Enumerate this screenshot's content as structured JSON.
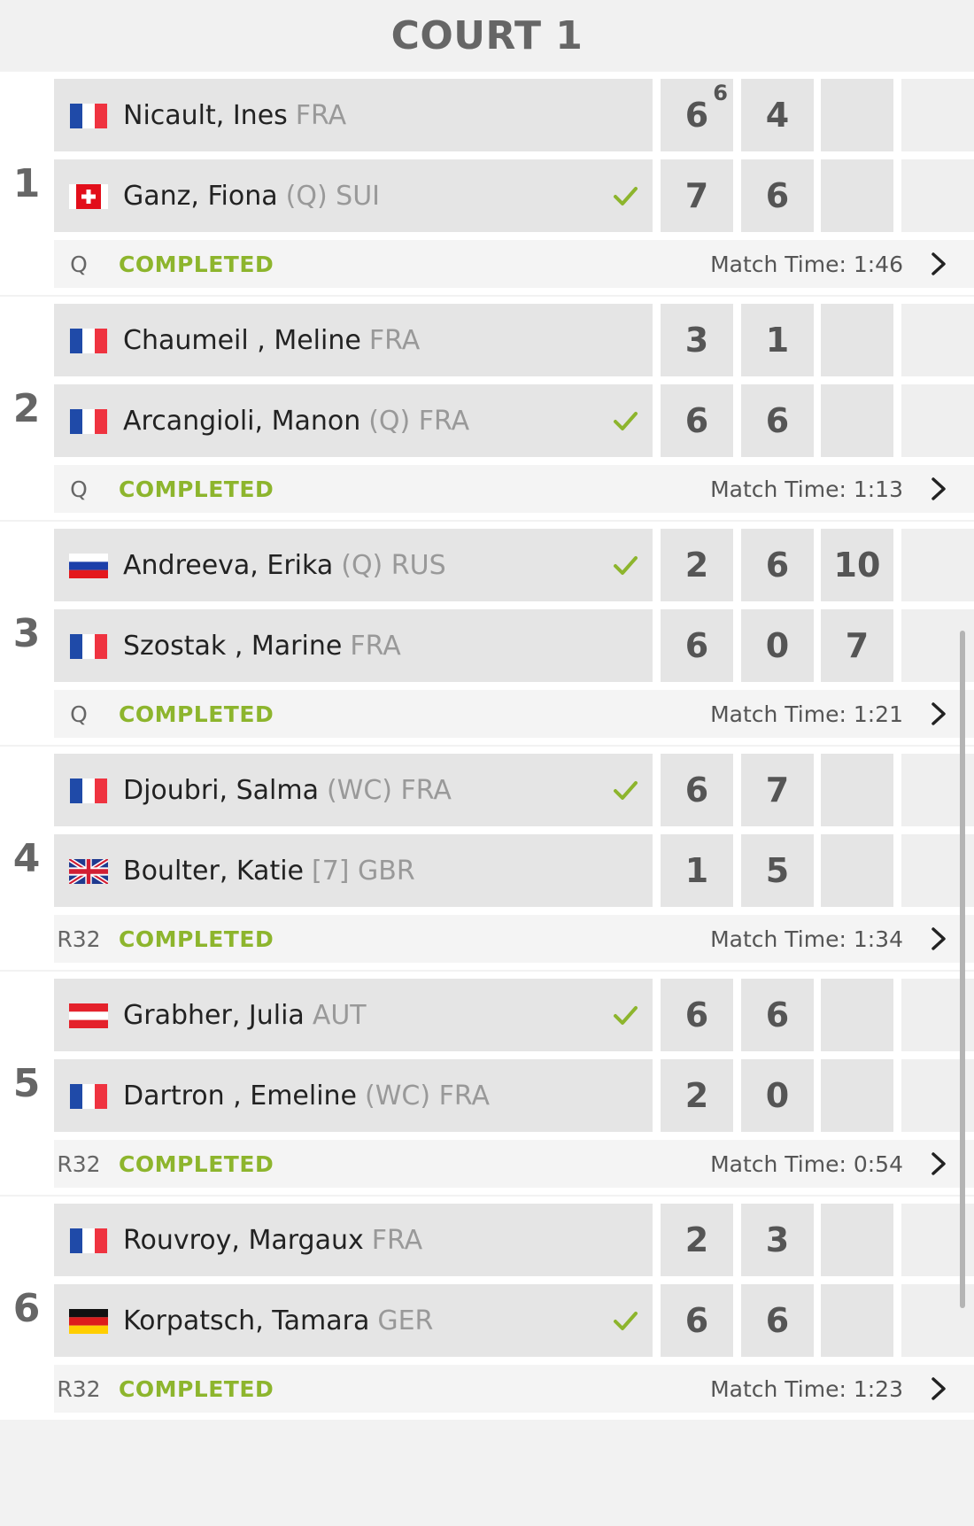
{
  "court": {
    "title": "COURT 1"
  },
  "matches": [
    {
      "num": "1",
      "round": "Q",
      "status": "COMPLETED",
      "match_time": "Match Time: 1:46",
      "players": [
        {
          "name": "Nicault, Ines",
          "extra": "FRA",
          "flag": "fra",
          "winner": false,
          "scores": [
            "6",
            "4",
            ""
          ],
          "tiebreak": [
            "6",
            "",
            ""
          ]
        },
        {
          "name": "Ganz, Fiona",
          "extra": "(Q) SUI",
          "flag": "sui",
          "winner": true,
          "scores": [
            "7",
            "6",
            ""
          ],
          "tiebreak": [
            "",
            "",
            ""
          ]
        }
      ]
    },
    {
      "num": "2",
      "round": "Q",
      "status": "COMPLETED",
      "match_time": "Match Time: 1:13",
      "players": [
        {
          "name": "Chaumeil , Meline",
          "extra": "FRA",
          "flag": "fra",
          "winner": false,
          "scores": [
            "3",
            "1",
            ""
          ],
          "tiebreak": [
            "",
            "",
            ""
          ]
        },
        {
          "name": "Arcangioli, Manon",
          "extra": "(Q) FRA",
          "flag": "fra",
          "winner": true,
          "scores": [
            "6",
            "6",
            ""
          ],
          "tiebreak": [
            "",
            "",
            ""
          ]
        }
      ]
    },
    {
      "num": "3",
      "round": "Q",
      "status": "COMPLETED",
      "match_time": "Match Time: 1:21",
      "players": [
        {
          "name": "Andreeva, Erika",
          "extra": "(Q) RUS",
          "flag": "rus",
          "winner": true,
          "scores": [
            "2",
            "6",
            "10"
          ],
          "tiebreak": [
            "",
            "",
            ""
          ]
        },
        {
          "name": "Szostak , Marine",
          "extra": "FRA",
          "flag": "fra",
          "winner": false,
          "scores": [
            "6",
            "0",
            "7"
          ],
          "tiebreak": [
            "",
            "",
            ""
          ]
        }
      ]
    },
    {
      "num": "4",
      "round": "R32",
      "status": "COMPLETED",
      "match_time": "Match Time: 1:34",
      "players": [
        {
          "name": "Djoubri, Salma",
          "extra": "(WC) FRA",
          "flag": "fra",
          "winner": true,
          "scores": [
            "6",
            "7",
            ""
          ],
          "tiebreak": [
            "",
            "",
            ""
          ]
        },
        {
          "name": "Boulter, Katie",
          "extra": "[7] GBR",
          "flag": "gbr",
          "winner": false,
          "scores": [
            "1",
            "5",
            ""
          ],
          "tiebreak": [
            "",
            "",
            ""
          ]
        }
      ]
    },
    {
      "num": "5",
      "round": "R32",
      "status": "COMPLETED",
      "match_time": "Match Time: 0:54",
      "players": [
        {
          "name": "Grabher, Julia",
          "extra": "AUT",
          "flag": "aut",
          "winner": true,
          "scores": [
            "6",
            "6",
            ""
          ],
          "tiebreak": [
            "",
            "",
            ""
          ]
        },
        {
          "name": "Dartron , Emeline",
          "extra": "(WC) FRA",
          "flag": "fra",
          "winner": false,
          "scores": [
            "2",
            "0",
            ""
          ],
          "tiebreak": [
            "",
            "",
            ""
          ]
        }
      ]
    },
    {
      "num": "6",
      "round": "R32",
      "status": "COMPLETED",
      "match_time": "Match Time: 1:23",
      "players": [
        {
          "name": "Rouvroy, Margaux",
          "extra": "FRA",
          "flag": "fra",
          "winner": false,
          "scores": [
            "2",
            "3",
            ""
          ],
          "tiebreak": [
            "",
            "",
            ""
          ]
        },
        {
          "name": "Korpatsch, Tamara",
          "extra": "GER",
          "flag": "ger",
          "winner": true,
          "scores": [
            "6",
            "6",
            ""
          ],
          "tiebreak": [
            "",
            "",
            ""
          ]
        }
      ]
    }
  ],
  "colors": {
    "status_green": "#8db52d",
    "check_green": "#8db52d",
    "row_gray": "#e5e5e5"
  },
  "icons": {
    "winner": "check-icon",
    "details": "chevron-right-icon"
  }
}
